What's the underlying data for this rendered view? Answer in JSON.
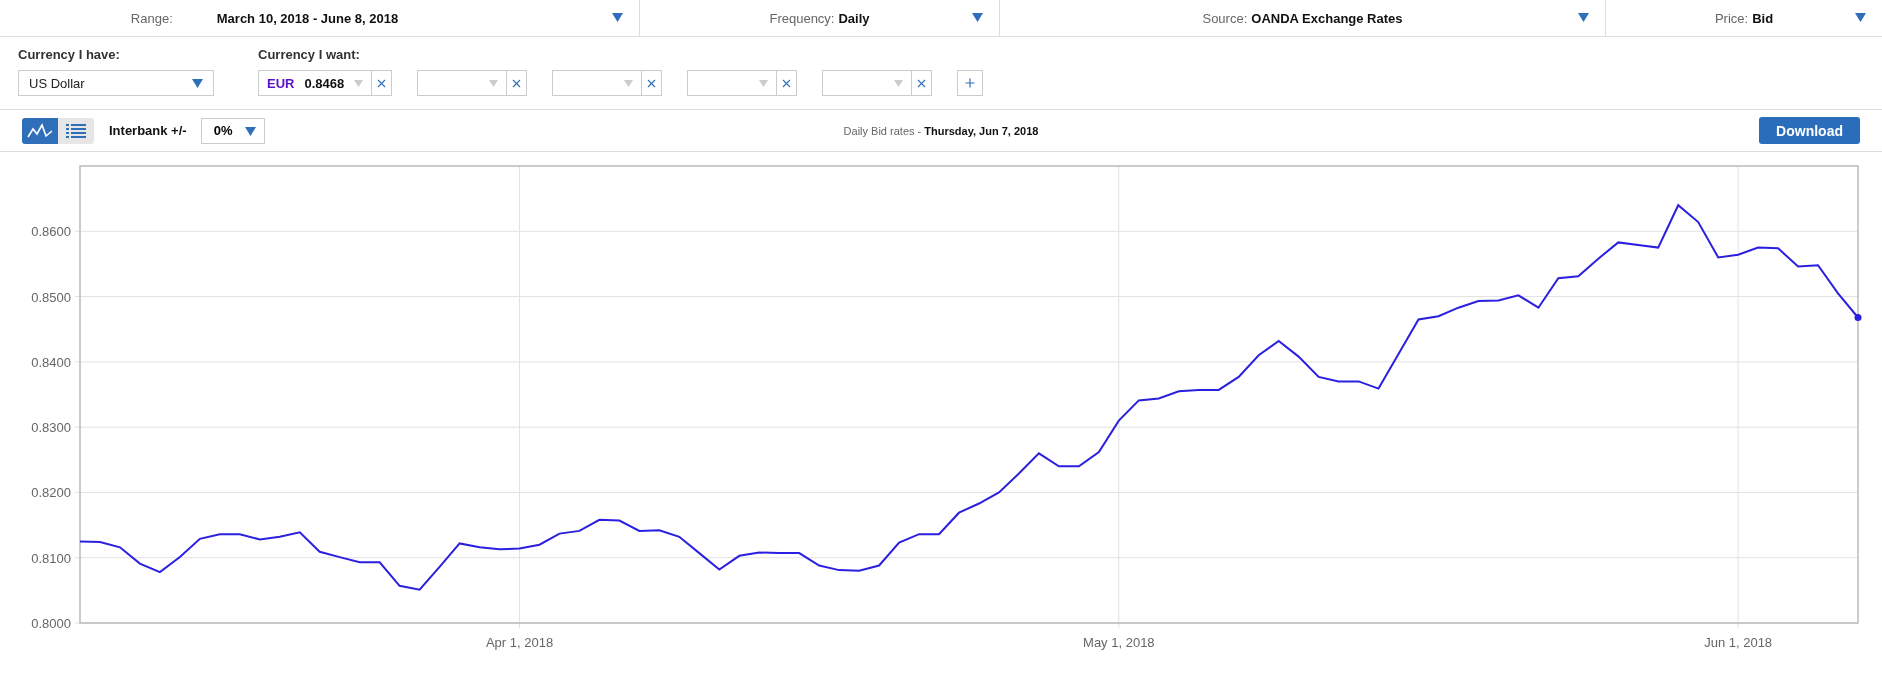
{
  "filters": [
    {
      "label": "Range:",
      "value": "March 10, 2018 - June 8, 2018"
    },
    {
      "label": "Frequency:",
      "value": "Daily"
    },
    {
      "label": "Source:",
      "value": "OANDA Exchange Rates"
    },
    {
      "label": "Price:",
      "value": "Bid"
    }
  ],
  "currency_have": {
    "label": "Currency I have:",
    "value": "US Dollar"
  },
  "currency_want": {
    "label": "Currency I want:",
    "items": [
      {
        "kind": "filled",
        "code": "EUR",
        "rate": "0.8468"
      },
      {
        "kind": "empty"
      },
      {
        "kind": "empty"
      },
      {
        "kind": "empty"
      },
      {
        "kind": "empty"
      }
    ]
  },
  "toolbar": {
    "views": [
      {
        "kind": "chart",
        "selected": true
      },
      {
        "kind": "table",
        "selected": false
      }
    ],
    "interbank": {
      "label": "Interbank +/-",
      "value": "0%"
    },
    "caption": "Daily Bid rates - **Thursday, Jun 7, 2018**",
    "download": "Download"
  },
  "chart": {
    "chart_data": {
      "type": "line",
      "grid": true,
      "categories": [
        null,
        null,
        null,
        null,
        null,
        null,
        null,
        null,
        null,
        null,
        null,
        null,
        null,
        null,
        null,
        null,
        null,
        null,
        null,
        null,
        null,
        null,
        "Apr 1, 2018",
        null,
        null,
        null,
        null,
        null,
        null,
        null,
        null,
        null,
        null,
        null,
        null,
        null,
        null,
        null,
        null,
        null,
        null,
        null,
        null,
        null,
        null,
        null,
        null,
        null,
        null,
        null,
        null,
        null,
        "May 1, 2018",
        null,
        null,
        null,
        null,
        null,
        null,
        null,
        null,
        null,
        null,
        null,
        null,
        null,
        null,
        null,
        null,
        null,
        null,
        null,
        null,
        null,
        null,
        null,
        null,
        null,
        null,
        null,
        null,
        null,
        null,
        "Jun 1, 2018",
        null,
        null,
        null,
        null,
        null,
        null
      ],
      "series": [
        {
          "color": "#2b1fe0",
          "values": [
            0.8125,
            0.8124,
            0.8116,
            0.8091,
            0.8078,
            0.8101,
            0.8129,
            0.8136,
            0.8136,
            0.8128,
            0.8132,
            0.8139,
            0.8109,
            0.8101,
            0.8093,
            0.8093,
            0.8057,
            0.8051,
            0.8086,
            0.8122,
            0.8116,
            0.8113,
            0.8114,
            0.812,
            0.8137,
            0.8141,
            0.8158,
            0.8157,
            0.8141,
            0.8142,
            0.8132,
            0.8107,
            0.8082,
            0.8103,
            0.8108,
            0.8107,
            0.8107,
            0.8088,
            0.8081,
            0.808,
            0.8088,
            0.8123,
            0.8136,
            0.8136,
            0.8169,
            0.8183,
            0.82,
            0.8229,
            0.826,
            0.824,
            0.824,
            0.8262,
            0.831,
            0.8341,
            0.8344,
            0.8355,
            0.8357,
            0.8357,
            0.8377,
            0.841,
            0.8432,
            0.8408,
            0.8377,
            0.837,
            0.837,
            0.8359,
            0.8412,
            0.8465,
            0.847,
            0.8483,
            0.8493,
            0.8494,
            0.8502,
            0.8483,
            0.8528,
            0.8531,
            0.8558,
            0.8583,
            0.8579,
            0.8575,
            0.864,
            0.8614,
            0.856,
            0.8564,
            0.8575,
            0.8574,
            0.8546,
            0.8548,
            0.8505,
            0.8468
          ]
        }
      ],
      "ylim": [
        0.8,
        0.87
      ],
      "yticks": [
        {
          "value": 0.8,
          "label": "0.8000"
        },
        {
          "value": 0.81,
          "label": "0.8100"
        },
        {
          "value": 0.82,
          "label": "0.8200"
        },
        {
          "value": 0.83,
          "label": "0.8300"
        },
        {
          "value": 0.84,
          "label": "0.8400"
        },
        {
          "value": 0.85,
          "label": "0.8500"
        },
        {
          "value": 0.86,
          "label": "0.8600"
        }
      ]
    }
  }
}
